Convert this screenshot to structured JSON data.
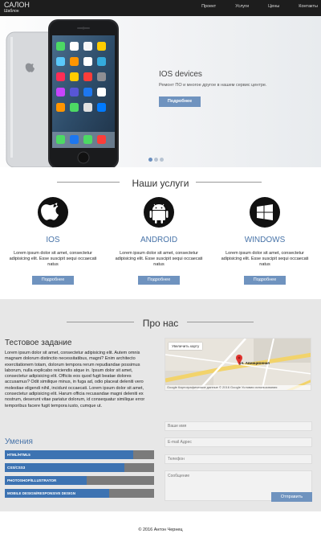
{
  "header": {
    "brand": "САЛОН",
    "subtitle": "Шаблон",
    "nav": [
      "Проект",
      "Услуги",
      "Цены",
      "Контакты"
    ]
  },
  "hero": {
    "title": "IOS devices",
    "text": "Ремонт ПО и многое другое в нашем сервис центре.",
    "button": "Подробнее",
    "slides": 3,
    "active_slide": 1
  },
  "services": {
    "heading": "Наши услуги",
    "items": [
      {
        "icon": "apple-icon",
        "title": "IOS",
        "text": "Lorem ipsum dolor sit amet, consectetur adipisicing elit. Esse suscipit sequi occaecati natus",
        "button": "Подробнее"
      },
      {
        "icon": "android-icon",
        "title": "ANDROID",
        "text": "Lorem ipsum dolor sit amet, consectetur adipisicing elit. Esse suscipit sequi occaecati natus",
        "button": "Подробнее"
      },
      {
        "icon": "windows-icon",
        "title": "WINDOWS",
        "text": "Lorem ipsum dolor sit amet, consectetur adipisicing elit. Esse suscipit sequi occaecati natus",
        "button": "Подробнее"
      }
    ]
  },
  "about": {
    "heading": "Про нас",
    "task_title": "Тестовое задание",
    "task_text": "Lorem ipsum dolor sit amet, consectetur adipisicing elit. Autem omnis magnam dolorum distinctio necessitatibus, magni? Enim architecto exercitationem totam, dolorum tempora rerum repudiandae possimus laborum, nulla explicabo reiciendis atque in. Ipsum dolor sit amet, consectetur adipisicing elit. Officiis eos quod fugit beatae dolores accusamus? Odit similique minus, in fuga ad, odio placeat deleniti vero molestiae eligendi nihil, incidunt occaecati. Lorem ipsum dolor sit amet, consectetur adipisicing elit. Harum officia recusandae magni deleniti ex nostrum, deserunt vitae pariatur dolorum, id consequatur similique error temporibus facere fugit tempora iusto, cumque ut.",
    "map": {
      "enlarge": "Увеличить карту",
      "street": "ул. Авиационная",
      "footer": "Google  Картографические данные © 2016 Google   Условия использования"
    },
    "skills_title": "Умения",
    "skills": [
      {
        "label": "HTML/HTML5",
        "level": 0.86
      },
      {
        "label": "CSS/CSS3",
        "level": 0.8
      },
      {
        "label": "PHOTOSHOP/ILLUSTRATOR",
        "level": 0.55
      },
      {
        "label": "MOBILE DESIGN/RESPONSIVE DESIGN",
        "level": 0.7
      }
    ],
    "form": {
      "name_placeholder": "Ваше имя",
      "email_placeholder": "E-mail Адрес",
      "phone_placeholder": "Телефон",
      "message_placeholder": "Сообщение",
      "send": "Отправить"
    }
  },
  "footer": {
    "copyright": "© 2016 Антон Чернец"
  },
  "colors": {
    "accent": "#4773a8",
    "button": "#6f93bf",
    "topbar": "#1d1d1d",
    "skill_fill": "#3d73b2",
    "skill_track": "#7b7b7b"
  }
}
